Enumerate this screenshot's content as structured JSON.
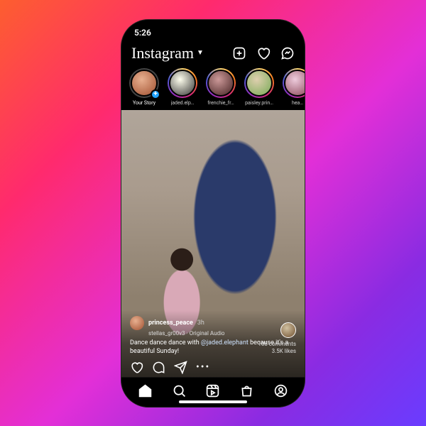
{
  "status": {
    "time": "5:26"
  },
  "header": {
    "logo": "Instagram"
  },
  "stories": [
    {
      "label": "Your Story",
      "mine": true
    },
    {
      "label": "jaded.elp…"
    },
    {
      "label": "frenchie_fr…"
    },
    {
      "label": "paisley.prin…"
    },
    {
      "label": "hea…"
    }
  ],
  "post": {
    "user": "princess_peace",
    "time": "3h",
    "subtitle": "stellas_gr00v3 · Original Audio",
    "caption_pre": "Dance dance dance with ",
    "mention": "@jaded.elephant",
    "caption_post": " because it's a beautiful Sunday!",
    "comments": "108 comments",
    "likes": "3.5K likes"
  }
}
